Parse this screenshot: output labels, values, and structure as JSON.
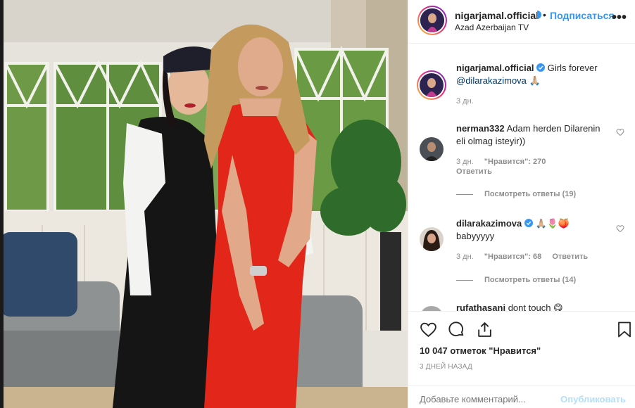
{
  "post": {
    "username": "nigarjamal.official",
    "follow_label": "Подписаться",
    "separator": "•",
    "location": "Azad Azerbaijan TV",
    "caption_user": "nigarjamal.official",
    "caption_text": "Girls forever",
    "caption_mention": "@dilarakazimova",
    "caption_emoji": "🙏🏼",
    "caption_time": "3 дн."
  },
  "comments": [
    {
      "username": "nerman332",
      "text": "Adam herden Dilarenin eli olmag isteyir))",
      "time": "3 дн.",
      "likes": "\"Нравится\": 270",
      "reply": "Ответить",
      "view_replies": "Посмотреть ответы (19)"
    },
    {
      "username": "dilarakazimova",
      "emojis": "🙏🏼🌷🍑",
      "text": "babyyyyy",
      "time": "3 дн.",
      "likes": "\"Нравится\": 68",
      "reply": "Ответить",
      "view_replies": "Посмотреть ответы (14)"
    },
    {
      "username": "rufathasani",
      "text": "dont touch 😋"
    }
  ],
  "actions": {
    "likes_count": "10 047 отметок \"Нравится\"",
    "date": "3 ДНЕЙ НАЗАД",
    "comment_placeholder": "Добавьте комментарий...",
    "post_label": "Опубликовать"
  },
  "colors": {
    "accent": "#3897f0",
    "text": "#262626",
    "muted": "#8e8e8e",
    "post_disabled": "#b2dffc"
  }
}
